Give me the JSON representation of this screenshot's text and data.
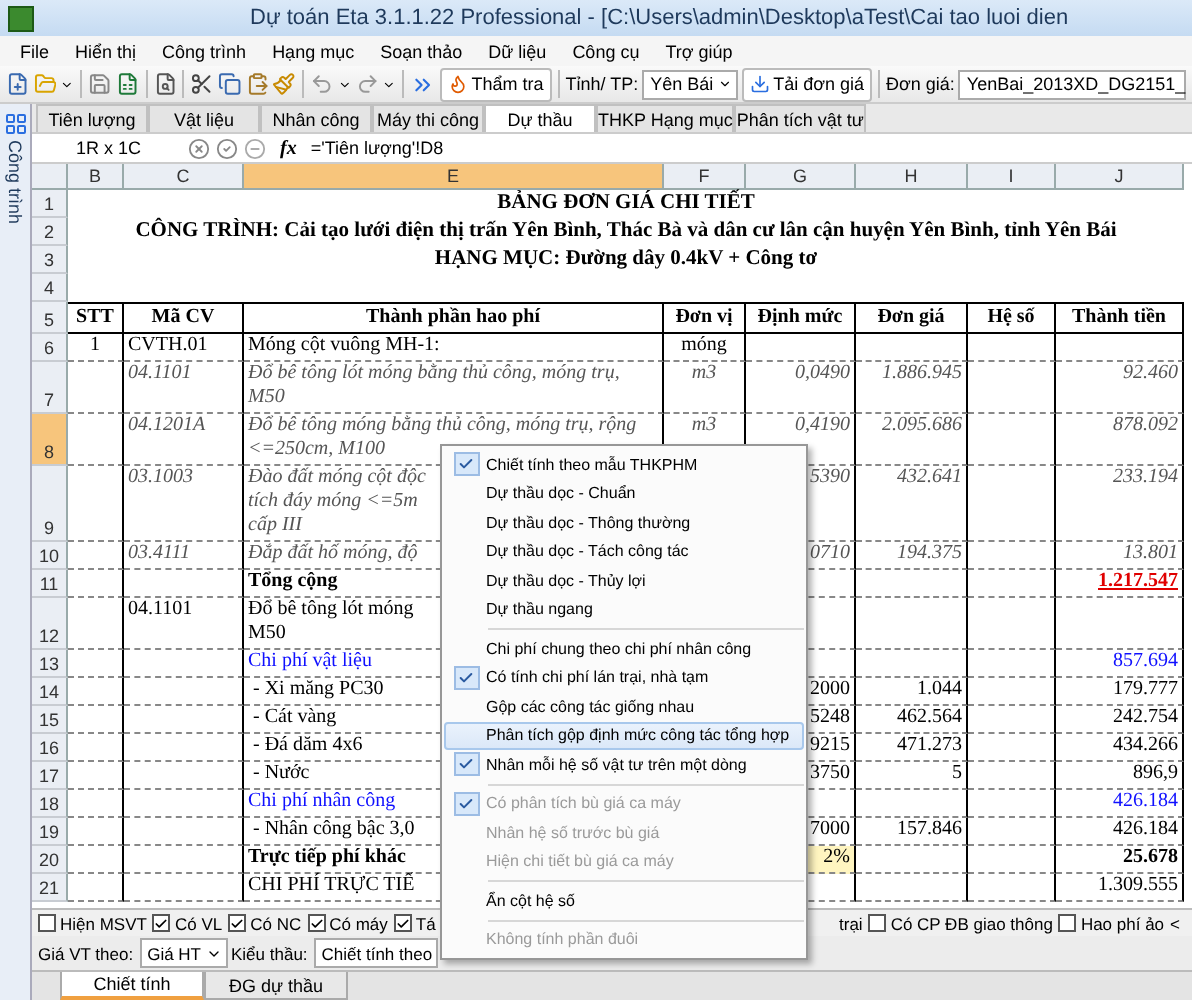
{
  "window": {
    "title": "Dự toán Eta 3.1.1.22 Professional - [C:\\Users\\admin\\Desktop\\aTest\\Cai tao luoi dien"
  },
  "menu_bar": [
    "File",
    "Hiển thị",
    "Công trình",
    "Hạng mục",
    "Soạn thảo",
    "Dữ liệu",
    "Công cụ",
    "Trợ giúp"
  ],
  "toolbar": {
    "review_button": "Thẩm tra",
    "province_label": "Tỉnh/ TP:",
    "province": "Yên Bái",
    "load_button": "Tải đơn giá",
    "price_label": "Đơn giá:",
    "price_set": "YenBai_2013XD_DG2151_"
  },
  "side_panel": {
    "title": "Công trình"
  },
  "tabs": [
    {
      "label": "Tiên lượng",
      "selected": false
    },
    {
      "label": "Vật liệu",
      "selected": false
    },
    {
      "label": "Nhân công",
      "selected": false
    },
    {
      "label": "Máy thi công",
      "selected": false
    },
    {
      "label": "Dự thầu",
      "selected": true
    },
    {
      "label": "THKP Hạng mục",
      "selected": false
    },
    {
      "label": "Phân tích vật tư",
      "selected": false
    }
  ],
  "formula_bar": {
    "reference": "1R x 1C",
    "fx": "fx",
    "formula": "='Tiên lượng'!D8"
  },
  "sheet": {
    "columns": [
      {
        "label": "B",
        "selected": false
      },
      {
        "label": "C",
        "selected": false
      },
      {
        "label": "E",
        "selected": true
      },
      {
        "label": "F",
        "selected": false
      },
      {
        "label": "G",
        "selected": false
      },
      {
        "label": "H",
        "selected": false
      },
      {
        "label": "I",
        "selected": false
      },
      {
        "label": "J",
        "selected": false
      }
    ],
    "rows": [
      {
        "number": "1",
        "selected": false,
        "kind": "title",
        "text": "BẢNG ĐƠN GIÁ CHI TIẾT"
      },
      {
        "number": "2",
        "selected": false,
        "kind": "title",
        "text": "CÔNG TRÌNH: Cải tạo lưới điện thị trấn Yên Bình, Thác Bà và dân cư lân cận huyện Yên Bình, tỉnh Yên Bái"
      },
      {
        "number": "3",
        "selected": false,
        "kind": "title",
        "text": "HẠNG MỤC: Đường dây 0.4kV + Công tơ"
      },
      {
        "number": "4",
        "selected": false,
        "kind": "blank"
      },
      {
        "number": "5",
        "selected": false,
        "kind": "header",
        "cells": {
          "B": "STT",
          "C": "Mã CV",
          "E": "Thành phần hao phí",
          "F": "Đơn vị",
          "G": "Định mức",
          "H": "Đơn giá",
          "I": "Hệ số",
          "J": "Thành tiền"
        }
      },
      {
        "number": "6",
        "selected": false,
        "kind": "task",
        "cells": {
          "B": "1",
          "C": "CVTH.01",
          "E": "Móng cột vuông MH-1:",
          "F": "móng"
        }
      },
      {
        "number": "7",
        "selected": false,
        "kind": "sub",
        "cells": {
          "C": "04.1101",
          "E": "Đổ bê tông lót móng bằng thủ công, móng trụ,\nM50",
          "F": "m3",
          "G": "0,0490",
          "H": "1.886.945",
          "J": "92.460"
        }
      },
      {
        "number": "8",
        "selected": true,
        "kind": "sub",
        "cells": {
          "C": "04.1201A",
          "E": "Đổ bê tông móng bằng thủ công, móng trụ, rộng\n<=250cm, M100",
          "F": "m3",
          "G": "0,4190",
          "H": "2.095.686",
          "J": "878.092"
        }
      },
      {
        "number": "9",
        "selected": false,
        "kind": "sub",
        "cells": {
          "C": "03.1003",
          "E": "Đào đất móng cột độc\ntích đáy móng <=5m\ncấp III",
          "G": "5390",
          "H": "432.641",
          "J": "233.194"
        }
      },
      {
        "number": "10",
        "selected": false,
        "kind": "sub",
        "cells": {
          "C": "03.4111",
          "E": "Đắp đất hố móng, độ",
          "G": "0710",
          "H": "194.375",
          "J": "13.801"
        }
      },
      {
        "number": "11",
        "selected": false,
        "kind": "total",
        "cells": {
          "E": "Tổng cộng",
          "J": "1.217.547"
        }
      },
      {
        "number": "12",
        "selected": false,
        "kind": "task",
        "cells": {
          "C": "04.1101",
          "E": "Đổ bê tông lót móng\nM50"
        }
      },
      {
        "number": "13",
        "selected": false,
        "kind": "group",
        "cells": {
          "E": "Chi phí vật liệu",
          "J": "857.694"
        }
      },
      {
        "number": "14",
        "selected": false,
        "kind": "task",
        "cells": {
          "E": " - Xi măng PC30",
          "G": "2000",
          "H": "1.044",
          "J": "179.777"
        }
      },
      {
        "number": "15",
        "selected": false,
        "kind": "task",
        "cells": {
          "E": " - Cát vàng",
          "G": "5248",
          "H": "462.564",
          "J": "242.754"
        }
      },
      {
        "number": "16",
        "selected": false,
        "kind": "task",
        "cells": {
          "E": " - Đá dăm 4x6",
          "G": "9215",
          "H": "471.273",
          "J": "434.266"
        }
      },
      {
        "number": "17",
        "selected": false,
        "kind": "task",
        "cells": {
          "E": " - Nước",
          "G": "3750",
          "H": "5",
          "J": "896,9"
        }
      },
      {
        "number": "18",
        "selected": false,
        "kind": "group",
        "cells": {
          "E": "Chi phí nhân công",
          "J": "426.184"
        }
      },
      {
        "number": "19",
        "selected": false,
        "kind": "task",
        "cells": {
          "E": " - Nhân công bậc 3,0",
          "G": "7000",
          "H": "157.846",
          "J": "426.184"
        }
      },
      {
        "number": "20",
        "selected": false,
        "kind": "subtotal",
        "cells": {
          "E": "Trực tiếp phí khác",
          "G": "2%",
          "J": "25.678"
        }
      },
      {
        "number": "21",
        "selected": false,
        "kind": "task",
        "cells": {
          "E": "CHI PHÍ TRỰC TIẾ",
          "J": "1.309.555"
        }
      }
    ]
  },
  "options": {
    "left": [
      {
        "label": "Hiện MSVT",
        "checked": false
      },
      {
        "label": "Có VL",
        "checked": true
      },
      {
        "label": "Có NC",
        "checked": true
      },
      {
        "label": "Có máy",
        "checked": true
      },
      {
        "label": "Tá",
        "checked": true
      }
    ],
    "right_note": "trại",
    "right": [
      {
        "label": "Có CP ĐB giao thông",
        "checked": false
      },
      {
        "label": "Hao phí ảo",
        "checked": false
      }
    ],
    "scroll": "<"
  },
  "bottom_bar": {
    "price_label": "Giá VT theo:",
    "price_basis": "Giá HT",
    "bid_label": "Kiểu thầu:",
    "bid_type": "Chiết tính theo"
  },
  "sheet_tabs": [
    {
      "label": "Chiết tính",
      "selected": true
    },
    {
      "label": "ĐG dự thầu",
      "selected": false
    }
  ],
  "context_menu": [
    {
      "kind": "item",
      "label": "Chiết tính theo mẫu THKPHM",
      "checked": true,
      "disabled": false,
      "selected": false
    },
    {
      "kind": "item",
      "label": "Dự thầu dọc - Chuẩn",
      "checked": false,
      "disabled": false,
      "selected": false
    },
    {
      "kind": "item",
      "label": "Dự thầu dọc - Thông thường",
      "checked": false,
      "disabled": false,
      "selected": false
    },
    {
      "kind": "item",
      "label": "Dự thầu dọc - Tách công tác",
      "checked": false,
      "disabled": false,
      "selected": false
    },
    {
      "kind": "item",
      "label": "Dự thầu dọc - Thủy lợi",
      "checked": false,
      "disabled": false,
      "selected": false
    },
    {
      "kind": "item",
      "label": "Dự thầu ngang",
      "checked": false,
      "disabled": false,
      "selected": false
    },
    {
      "kind": "separator"
    },
    {
      "kind": "item",
      "label": "Chi phí chung theo chi phí nhân công",
      "checked": false,
      "disabled": false,
      "selected": false
    },
    {
      "kind": "item",
      "label": "Có tính chi phí lán trại, nhà tạm",
      "checked": true,
      "disabled": false,
      "selected": false
    },
    {
      "kind": "item",
      "label": "Gộp các công tác giống nhau",
      "checked": false,
      "disabled": false,
      "selected": false
    },
    {
      "kind": "item",
      "label": "Phân tích gộp định mức công tác tổng hợp",
      "checked": false,
      "disabled": false,
      "selected": true
    },
    {
      "kind": "item",
      "label": "Nhân mỗi hệ số vật tư trên một dòng",
      "checked": true,
      "disabled": false,
      "selected": false
    },
    {
      "kind": "separator"
    },
    {
      "kind": "item",
      "label": "Có phân tích bù giá ca máy",
      "checked": true,
      "disabled": true,
      "selected": false
    },
    {
      "kind": "item",
      "label": "Nhân hệ số trước bù giá",
      "checked": false,
      "disabled": true,
      "selected": false
    },
    {
      "kind": "item",
      "label": "Hiện chi tiết bù giá ca máy",
      "checked": false,
      "disabled": true,
      "selected": false
    },
    {
      "kind": "separator"
    },
    {
      "kind": "item",
      "label": "Ẩn cột hệ số",
      "checked": false,
      "disabled": false,
      "selected": false
    },
    {
      "kind": "separator"
    },
    {
      "kind": "item",
      "label": "Không tính phần đuôi",
      "checked": false,
      "disabled": true,
      "selected": false
    }
  ]
}
